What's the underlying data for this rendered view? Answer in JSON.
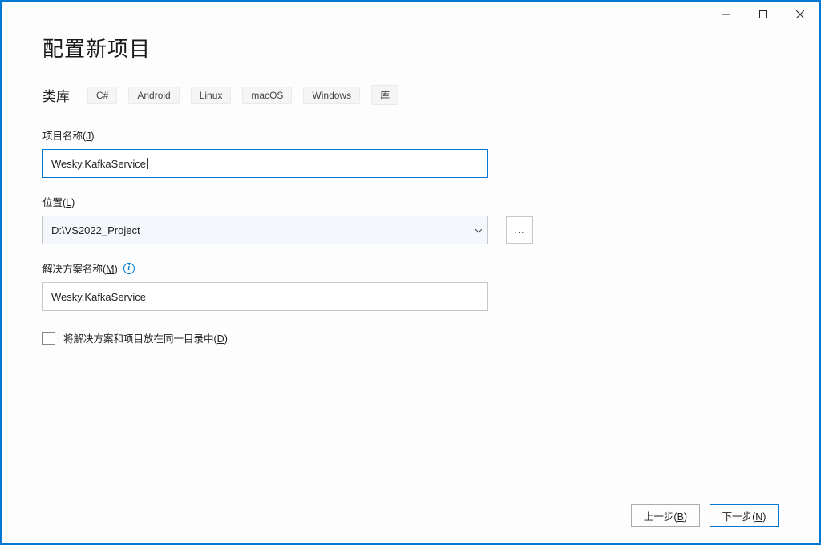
{
  "title": "配置新项目",
  "filters": {
    "label": "类库",
    "pills": [
      "C#",
      "Android",
      "Linux",
      "macOS",
      "Windows",
      "库"
    ]
  },
  "project_name": {
    "label_pre": "项目名称(",
    "label_access": "J",
    "label_post": ")",
    "value": "Wesky.KafkaService"
  },
  "location": {
    "label_pre": "位置(",
    "label_access": "L",
    "label_post": ")",
    "value": "D:\\VS2022_Project",
    "browse": "..."
  },
  "solution_name": {
    "label_pre": "解决方案名称(",
    "label_access": "M",
    "label_post": ")",
    "info_glyph": "i",
    "value": "Wesky.KafkaService"
  },
  "same_dir": {
    "label_pre": "将解决方案和项目放在同一目录中(",
    "label_access": "D",
    "label_post": ")"
  },
  "footer": {
    "back_pre": "上一步(",
    "back_access": "B",
    "back_post": ")",
    "next_pre": "下一步(",
    "next_access": "N",
    "next_post": ")"
  }
}
